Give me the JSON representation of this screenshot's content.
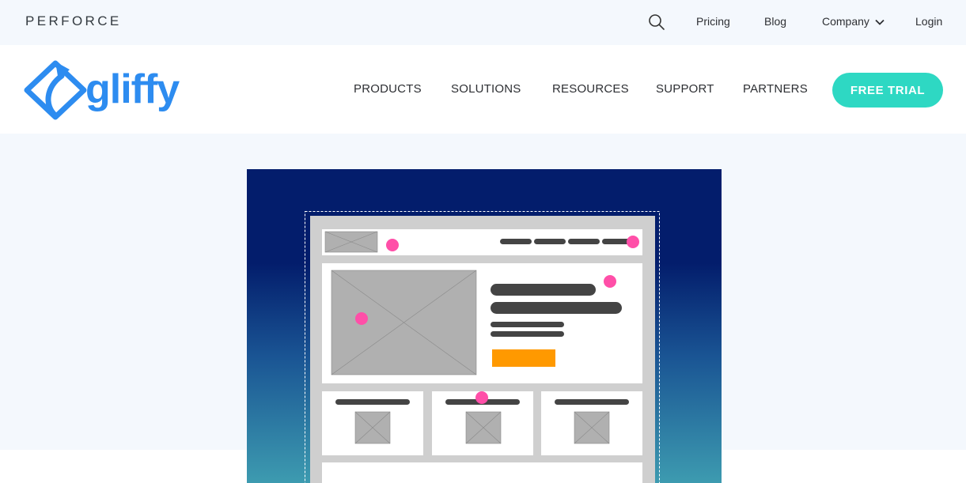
{
  "topbar": {
    "brand": "PERFORCE",
    "links": {
      "pricing": "Pricing",
      "blog": "Blog",
      "company": "Company",
      "login": "Login"
    },
    "search_icon": "search-icon"
  },
  "nav": {
    "logo_text": "gliffy",
    "items": {
      "products": "PRODUCTS",
      "solutions": "SOLUTIONS",
      "resources": "RESOURCES",
      "support": "SUPPORT",
      "partners": "PARTNERS"
    },
    "cta": "FREE TRIAL"
  },
  "colors": {
    "brand_blue": "#2d8cf0",
    "cta": "#2ed8c3",
    "hero_bg": "#f4f8fd",
    "illustration_top": "#031d6c",
    "illustration_bottom": "#3d9bb0",
    "hotspot": "#ff4fa8",
    "button_orange": "#ff9900"
  }
}
